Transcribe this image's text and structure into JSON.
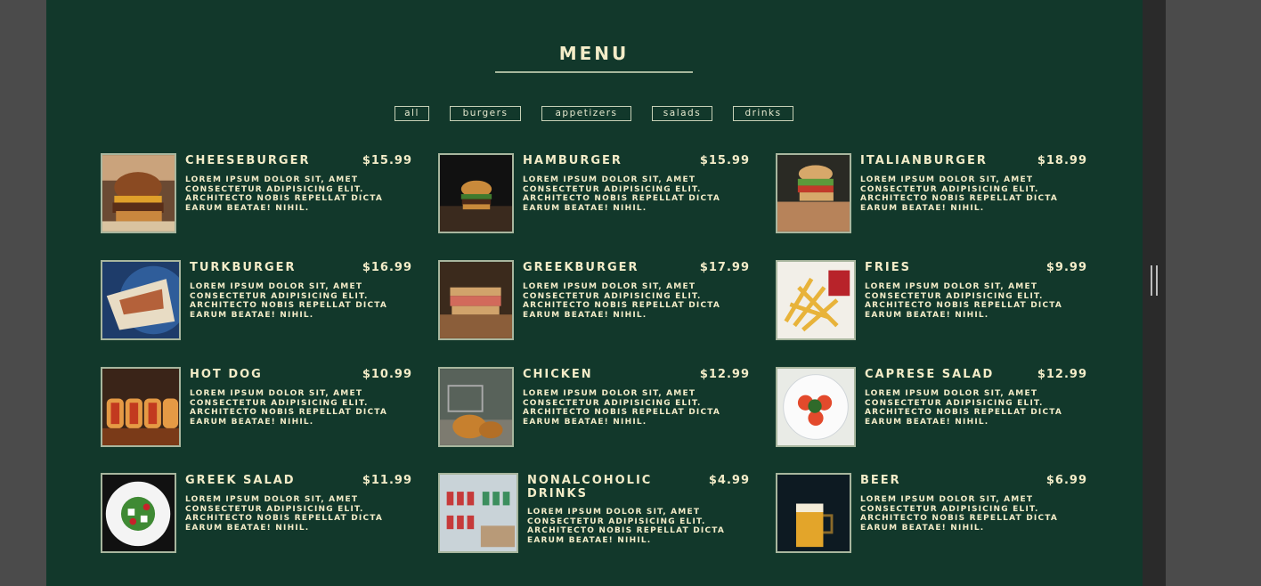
{
  "menu": {
    "title": "MENU"
  },
  "filters": [
    "all",
    "burgers",
    "appetizers",
    "salads",
    "drinks"
  ],
  "description": "LOREM IPSUM DOLOR SIT, AMET CONSECTETUR ADIPISICING ELIT. ARCHITECTO NOBIS REPELLAT DICTA EARUM BEATAE! NIHIL.",
  "items": [
    {
      "name": "CHEESEBURGER",
      "price": "$15.99",
      "image": "cheeseburger-photo"
    },
    {
      "name": "HAMBURGER",
      "price": "$15.99",
      "image": "hamburger-photo"
    },
    {
      "name": "ITALIANBURGER",
      "price": "$18.99",
      "image": "italianburger-photo"
    },
    {
      "name": "TURKBURGER",
      "price": "$16.99",
      "image": "turkburger-photo"
    },
    {
      "name": "GREEKBURGER",
      "price": "$17.99",
      "image": "greekburger-photo"
    },
    {
      "name": "FRIES",
      "price": "$9.99",
      "image": "fries-photo"
    },
    {
      "name": "HOT DOG",
      "price": "$10.99",
      "image": "hotdog-photo"
    },
    {
      "name": "CHICKEN",
      "price": "$12.99",
      "image": "chicken-photo"
    },
    {
      "name": "CAPRESE SALAD",
      "price": "$12.99",
      "image": "caprese-salad-photo"
    },
    {
      "name": "GREEK SALAD",
      "price": "$11.99",
      "image": "greek-salad-photo"
    },
    {
      "name": "NONALCOHOLIC DRINKS",
      "price": "$4.99",
      "image": "nonalcoholic-drinks-photo"
    },
    {
      "name": "BEER",
      "price": "$6.99",
      "image": "beer-photo"
    }
  ],
  "colors": {
    "background": "#12382b",
    "text": "#f3ecc8",
    "accent": "#a6b79c"
  }
}
